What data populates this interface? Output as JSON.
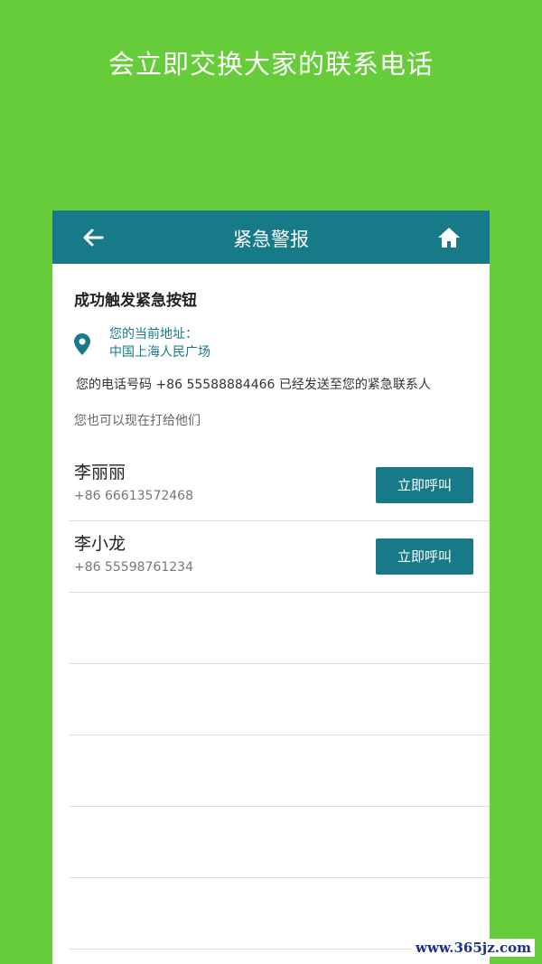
{
  "promo": {
    "caption": "会立即交换大家的联系电话"
  },
  "app_bar": {
    "title": "紧急警报",
    "back_icon": "arrow-left-icon",
    "home_icon": "home-icon"
  },
  "alert": {
    "heading": "成功触发紧急按钮",
    "location_label": "您的当前地址：",
    "location_value": "中国上海人民广场",
    "sent_message": "您的电话号码 +86 55588884466 已经发送至您的紧急联系人",
    "call_hint": "您也可以现在打给他们"
  },
  "contacts": [
    {
      "name": "李丽丽",
      "phone": "+86 66613572468",
      "call_label": "立即呼叫"
    },
    {
      "name": "李小龙",
      "phone": "+86 55598761234",
      "call_label": "立即呼叫"
    }
  ],
  "watermark": "www.365jz.com",
  "colors": {
    "background": "#66cc3a",
    "accent": "#177a89"
  }
}
